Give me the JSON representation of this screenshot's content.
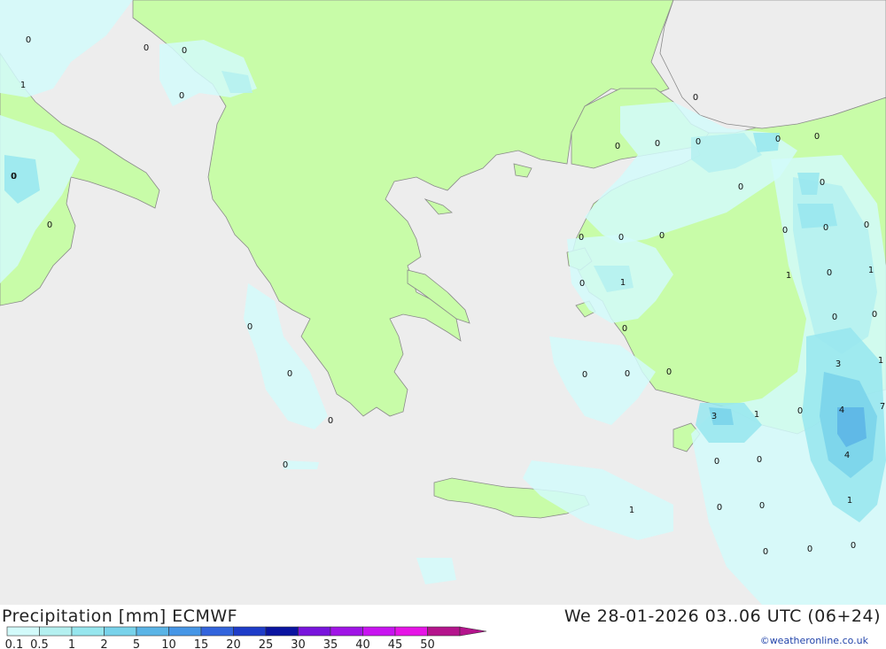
{
  "header": {
    "title": "Precipitation [mm] ECMWF",
    "datetime": "We 28-01-2026 03..06 UTC (06+24)",
    "credit": "©weatheronline.co.uk"
  },
  "legend": {
    "ticks": [
      "0.1",
      "0.5",
      "1",
      "2",
      "5",
      "10",
      "15",
      "20",
      "25",
      "30",
      "35",
      "40",
      "45",
      "50"
    ],
    "colors": [
      "#d2fafa",
      "#b4f0f0",
      "#96e6ee",
      "#78d2ea",
      "#5ab4e6",
      "#4696e6",
      "#3264dc",
      "#1e3cc8",
      "#0a14a0",
      "#7814dc",
      "#a014e6",
      "#c814f0",
      "#e614e6",
      "#b4148c"
    ]
  },
  "colors": {
    "sea": "#ededed",
    "land": "#c8fca8",
    "land_outside": "#ededed",
    "border": "#8a8a8a"
  },
  "map_values": [
    "0",
    "0",
    "0",
    "1",
    "0",
    "0",
    "0",
    "0",
    "0",
    "0",
    "0",
    "0",
    "0",
    "0",
    "0",
    "0",
    "0",
    "0",
    "0",
    "0",
    "0",
    "0",
    "0",
    "0",
    "0",
    "0",
    "1",
    "1",
    "0",
    "1",
    "0",
    "0",
    "0",
    "3",
    "1",
    "0",
    "0",
    "3",
    "1",
    "4",
    "7",
    "4",
    "0",
    "0",
    "1",
    "0",
    "0",
    "1",
    "0",
    "0",
    "0",
    "0",
    "0",
    "0"
  ]
}
